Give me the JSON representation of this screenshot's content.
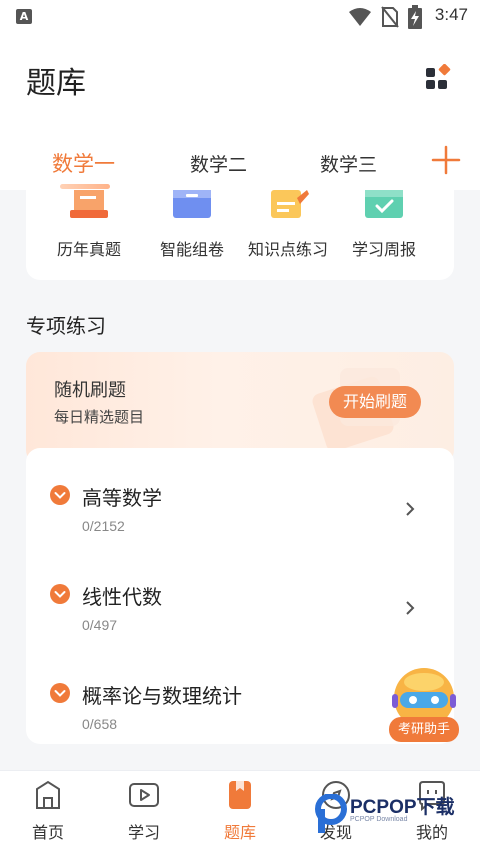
{
  "status_bar": {
    "time": "3:47",
    "app_badge": "A"
  },
  "header": {
    "title": "题库"
  },
  "tabs": [
    {
      "label": "数学一",
      "active": true
    },
    {
      "label": "数学二",
      "active": false
    },
    {
      "label": "数学三",
      "active": false
    }
  ],
  "quick_entries": [
    {
      "label": "历年真题",
      "icon": "exam-paper-icon"
    },
    {
      "label": "智能组卷",
      "icon": "folder-box-icon"
    },
    {
      "label": "知识点练习",
      "icon": "knowledge-note-icon"
    },
    {
      "label": "学习周报",
      "icon": "weekly-report-icon"
    }
  ],
  "section": {
    "title": "专项练习"
  },
  "random_practice": {
    "title": "随机刷题",
    "subtitle": "每日精选题目",
    "button": "开始刷题"
  },
  "subjects": [
    {
      "name": "高等数学",
      "progress": "0/2152"
    },
    {
      "name": "线性代数",
      "progress": "0/497"
    },
    {
      "name": "概率论与数理统计",
      "progress": "0/658"
    }
  ],
  "assistant": {
    "label": "考研助手"
  },
  "bottom_nav": [
    {
      "label": "首页",
      "icon": "home-icon",
      "active": false
    },
    {
      "label": "学习",
      "icon": "video-play-icon",
      "active": false
    },
    {
      "label": "题库",
      "icon": "question-bank-icon",
      "active": true
    },
    {
      "label": "发现",
      "icon": "discover-icon",
      "active": false
    },
    {
      "label": "我的",
      "icon": "profile-icon",
      "active": false
    }
  ],
  "watermark": {
    "text": "PCPOP下载",
    "sub": "PCPOP Download"
  },
  "colors": {
    "accent": "#f07a3a",
    "button": "#f28a52",
    "background": "#f5f6f8"
  }
}
